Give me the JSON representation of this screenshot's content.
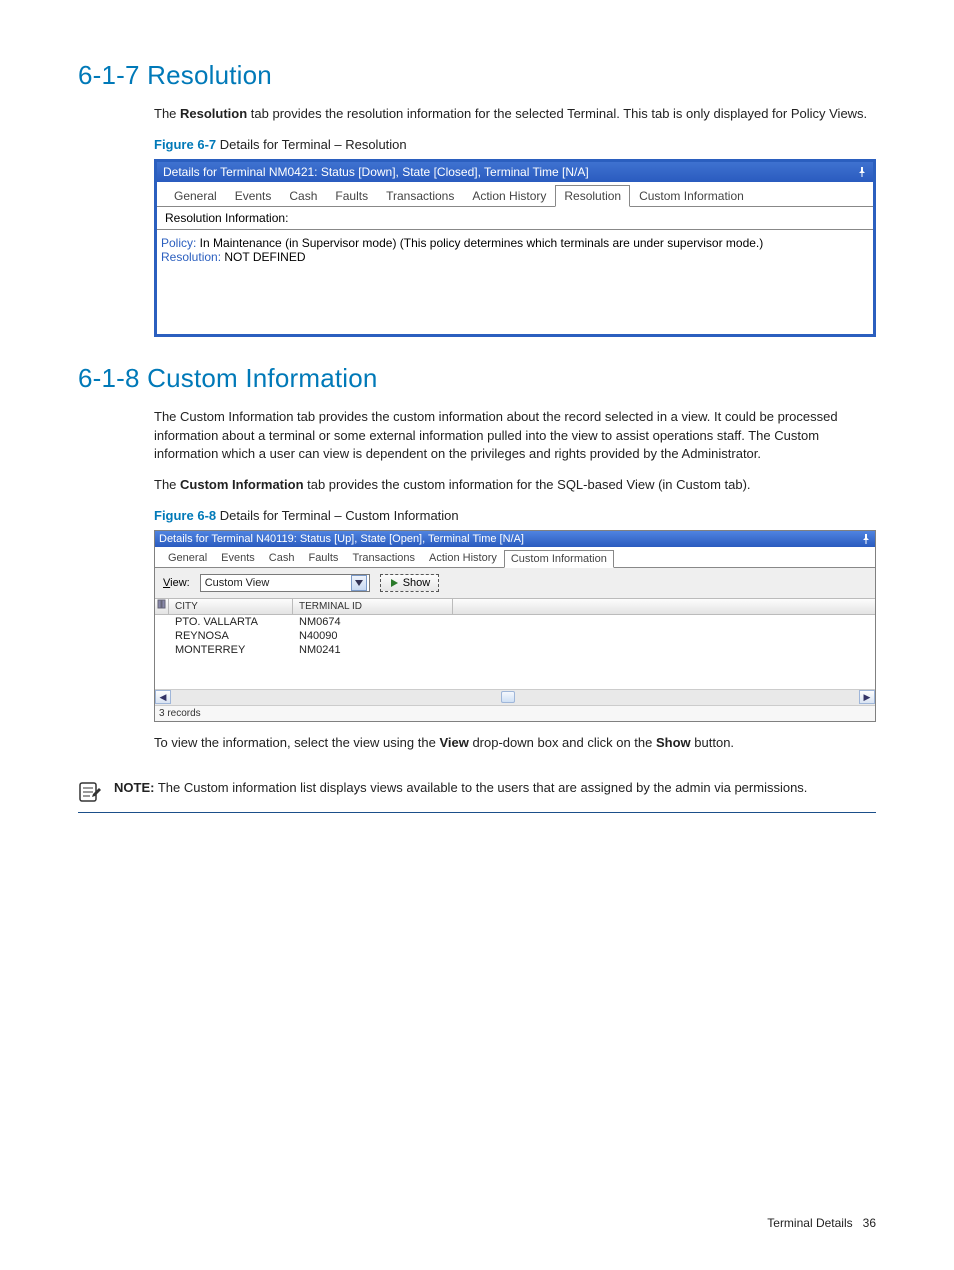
{
  "section1": {
    "heading": "6-1-7 Resolution",
    "para1_pre": "The ",
    "para1_bold": "Resolution",
    "para1_post": " tab provides the resolution information for the selected Terminal.  This tab is only displayed for Policy Views.",
    "fig_label": "Figure 6-7",
    "fig_caption": " Details for Terminal – Resolution",
    "panel": {
      "title": "Details for Terminal NM0421: Status [Down], State [Closed], Terminal Time [N/A]",
      "tabs": [
        "General",
        "Events",
        "Cash",
        "Faults",
        "Transactions",
        "Action History",
        "Resolution",
        "Custom Information"
      ],
      "active_tab_index": 6,
      "sub_header": "Resolution Information:",
      "line1_label": "Policy:",
      "line1_value": " In Maintenance (in Supervisor mode) (This policy determines which terminals are under supervisor mode.)",
      "line2_label": "Resolution:",
      "line2_value": " NOT DEFINED"
    }
  },
  "section2": {
    "heading": "6-1-8 Custom Information",
    "para1": "The Custom Information tab provides the custom information about the record selected in a view.  It could be processed information about a terminal or some external information pulled into the view to assist operations staff.  The Custom information which a user can view is dependent on the privileges and rights provided by the Administrator.",
    "para2_pre": "The ",
    "para2_bold": "Custom Information",
    "para2_post": " tab provides the custom information for the SQL-based View (in Custom tab).",
    "fig_label": "Figure 6-8",
    "fig_caption": " Details for Terminal – Custom Information",
    "panel": {
      "title": "Details for Terminal N40119: Status [Up], State [Open], Terminal Time [N/A]",
      "tabs": [
        "General",
        "Events",
        "Cash",
        "Faults",
        "Transactions",
        "Action History",
        "Custom Information"
      ],
      "active_tab_index": 6,
      "view_label_u": "V",
      "view_label_rest": "iew:",
      "dropdown_value": "Custom View",
      "show_button": "Show",
      "columns": [
        "CITY",
        "TERMINAL ID"
      ],
      "rows": [
        {
          "city": "PTO. VALLARTA",
          "tid": "NM0674"
        },
        {
          "city": "REYNOSA",
          "tid": "N40090"
        },
        {
          "city": "MONTERREY",
          "tid": "NM0241"
        }
      ],
      "status": "3 records"
    },
    "para3_pre": "To view the information, select the view using the ",
    "para3_bold1": "View",
    "para3_mid": " drop-down box and click on the ",
    "para3_bold2": "Show",
    "para3_post": " button.",
    "note_bold": "NOTE:",
    "note_text": "  The Custom information list displays views available to the users that are assigned by the admin via permissions."
  },
  "footer": {
    "label": "Terminal Details",
    "page": "36"
  }
}
